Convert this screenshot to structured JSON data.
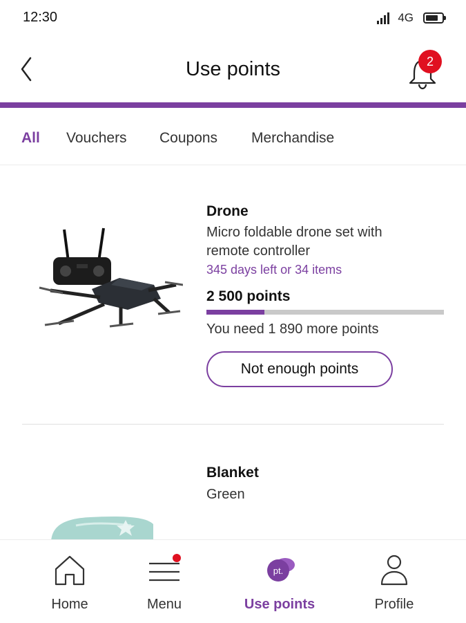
{
  "status_bar": {
    "time": "12:30",
    "network": "4G"
  },
  "header": {
    "title": "Use points",
    "notification_count": "2"
  },
  "colors": {
    "accent": "#7b3fa0",
    "badge": "#e01020"
  },
  "tabs": [
    {
      "label": "All",
      "active": true
    },
    {
      "label": "Vouchers"
    },
    {
      "label": "Coupons"
    },
    {
      "label": "Merchandise"
    }
  ],
  "products": [
    {
      "name": "Drone",
      "description": "Micro foldable drone set with remote controller",
      "availability": "345 days left or 34 items",
      "points": "2 500 points",
      "progress_fraction": 0.244,
      "points_needed": "You need 1 890 more points",
      "button_label": "Not enough points",
      "image_icon": "drone-image"
    },
    {
      "name": "Blanket",
      "description": "Green",
      "image_icon": "blanket-image"
    }
  ],
  "bottom_nav": [
    {
      "label": "Home",
      "icon": "home-icon"
    },
    {
      "label": "Menu",
      "icon": "menu-icon",
      "has_dot": true
    },
    {
      "label": "Use points",
      "icon": "points-icon",
      "active": true,
      "icon_text": "pt."
    },
    {
      "label": "Profile",
      "icon": "profile-icon"
    }
  ]
}
